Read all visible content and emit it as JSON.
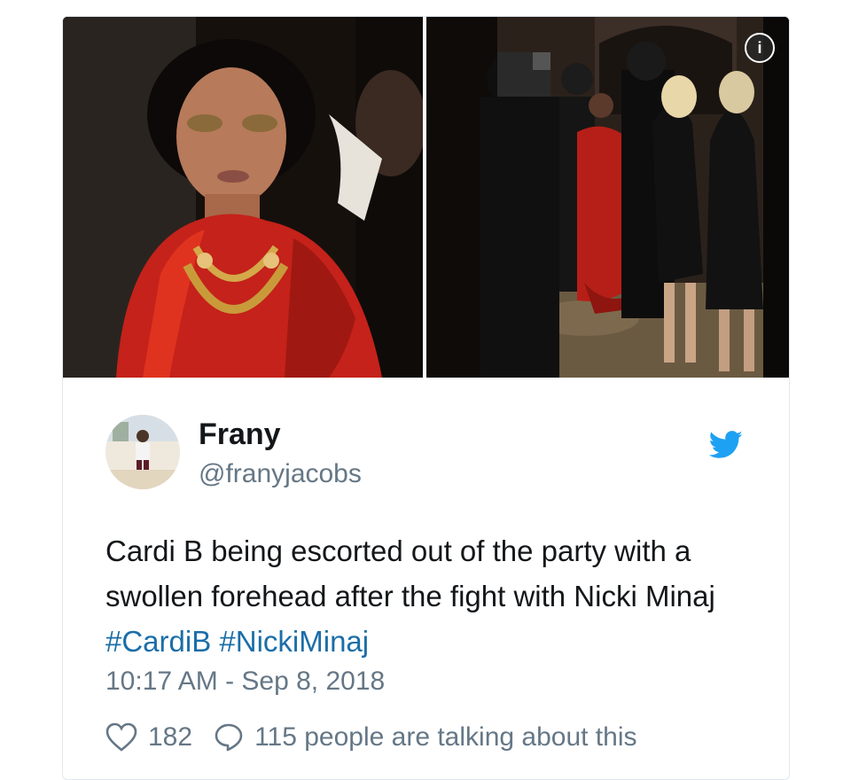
{
  "media": {
    "left_photo_alt": "woman in red ruffled dress with gold jewelry",
    "right_photo_alt": "woman in red dress being escorted through a crowd",
    "info_icon": "info-icon"
  },
  "tweet": {
    "author_name": "Frany",
    "author_handle": "@franyjacobs",
    "text_main": "Cardi B being escorted out of the party with a swollen forehead after the fight with Nicki Minaj ",
    "hashtags": [
      "#CardiB",
      "#NickiMinaj"
    ],
    "timestamp": "10:17 AM - Sep 8, 2018",
    "like_count": "182",
    "talking_text": "115 people are talking about this"
  },
  "colors": {
    "hashtag": "#1b6ea8",
    "twitter_blue": "#1da1f2",
    "secondary_text": "#657786"
  },
  "icons": [
    "info-icon",
    "twitter-bird-icon",
    "heart-icon",
    "comment-bubble-icon"
  ]
}
